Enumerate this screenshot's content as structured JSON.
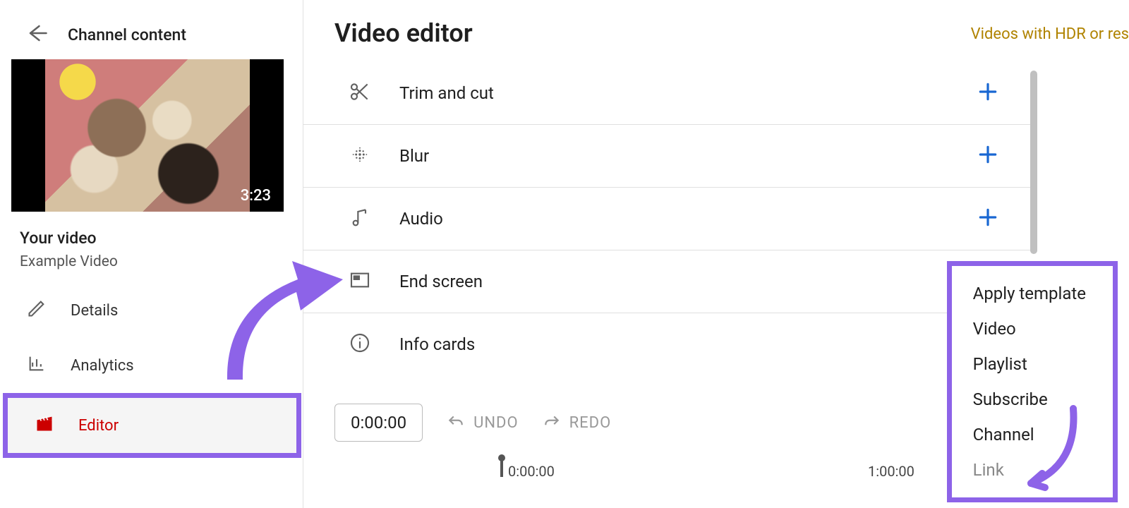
{
  "sidebar": {
    "back_title": "Channel content",
    "thumb_time": "3:23",
    "section_title": "Your video",
    "video_title": "Example Video",
    "nav": [
      {
        "label": "Details",
        "icon": "pencil"
      },
      {
        "label": "Analytics",
        "icon": "bars"
      },
      {
        "label": "Editor",
        "icon": "clapboard"
      }
    ]
  },
  "main": {
    "title": "Video editor",
    "hdr_link": "Videos with HDR or res",
    "tools": [
      {
        "label": "Trim and cut",
        "icon": "scissors",
        "plus": true
      },
      {
        "label": "Blur",
        "icon": "dots",
        "plus": true
      },
      {
        "label": "Audio",
        "icon": "note",
        "plus": true
      },
      {
        "label": "End screen",
        "icon": "screen",
        "plus": false
      },
      {
        "label": "Info cards",
        "icon": "info",
        "plus": false
      }
    ],
    "time_value": "0:00:00",
    "undo_label": "UNDO",
    "redo_label": "REDO",
    "tick_start": "0:00:00",
    "tick_mid": "1:00:00"
  },
  "dropdown": {
    "items": [
      {
        "label": "Apply template"
      },
      {
        "label": "Video"
      },
      {
        "label": "Playlist"
      },
      {
        "label": "Subscribe"
      },
      {
        "label": "Channel"
      },
      {
        "label": "Link",
        "disabled": true
      }
    ]
  }
}
